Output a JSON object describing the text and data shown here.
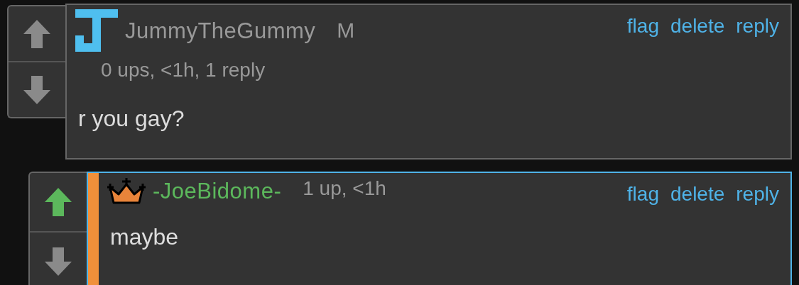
{
  "comments": [
    {
      "kind": "top",
      "avatar": {
        "kind": "letter"
      },
      "username": "JummyTheGummy",
      "color": "#999999",
      "tag": "M",
      "meta": "0 ups, <1h, 1 reply",
      "upvoted": false,
      "highlighted": false,
      "actions": [
        "flag",
        "delete",
        "reply"
      ],
      "text": "r you gay?"
    },
    {
      "kind": "reply",
      "avatar": {
        "kind": "crown"
      },
      "username": "-JoeBidome-",
      "color": "#5cb85c",
      "meta": "1 up, <1h",
      "upvoted": true,
      "highlighted": true,
      "actions": [
        "flag",
        "delete",
        "reply"
      ],
      "text": "maybe"
    }
  ]
}
